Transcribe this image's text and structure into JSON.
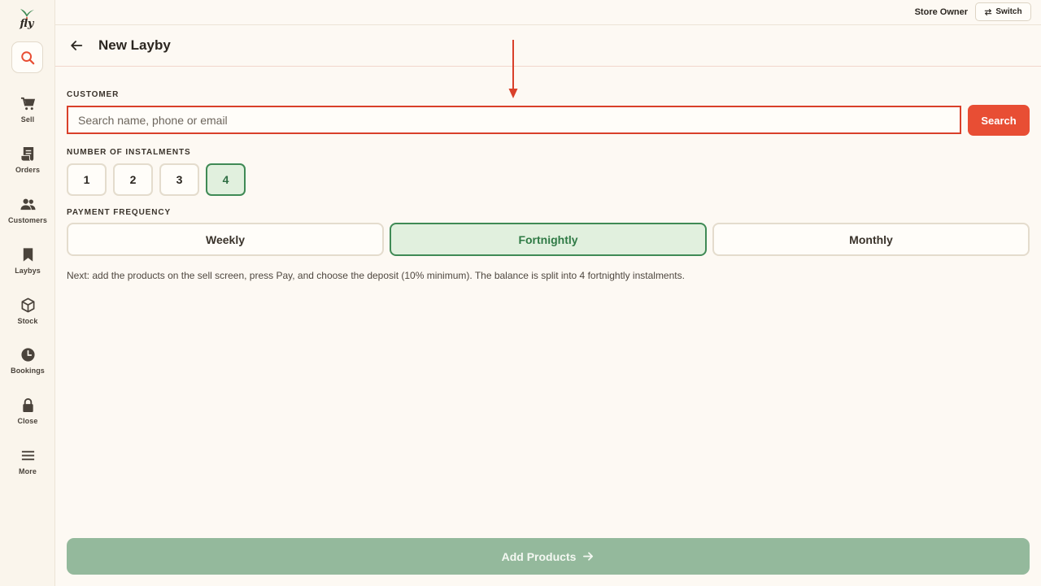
{
  "app": {
    "logo_text": "fly"
  },
  "sidebar": {
    "items": [
      {
        "label": "Sell",
        "icon": "cart-icon"
      },
      {
        "label": "Orders",
        "icon": "receipt-icon"
      },
      {
        "label": "Customers",
        "icon": "users-icon"
      },
      {
        "label": "Laybys",
        "icon": "bookmark-icon"
      },
      {
        "label": "Stock",
        "icon": "box-icon"
      },
      {
        "label": "Bookings",
        "icon": "clock-icon"
      },
      {
        "label": "Close",
        "icon": "lock-icon"
      },
      {
        "label": "More",
        "icon": "menu-icon"
      }
    ]
  },
  "topbar": {
    "user_label": "Store Owner",
    "switch_label": "Switch"
  },
  "header": {
    "title": "New Layby"
  },
  "customer": {
    "label": "CUSTOMER",
    "placeholder": "Search name, phone or email",
    "value": "",
    "search_label": "Search"
  },
  "instalments": {
    "label": "NUMBER OF INSTALMENTS",
    "options": [
      "1",
      "2",
      "3",
      "4"
    ],
    "selected": "4"
  },
  "frequency": {
    "label": "PAYMENT FREQUENCY",
    "options": [
      "Weekly",
      "Fortnightly",
      "Monthly"
    ],
    "selected": "Fortnightly"
  },
  "hint": "Next: add the products on the sell screen, press Pay, and choose the deposit (10% minimum). The balance is split into 4 fortnightly instalments.",
  "footer": {
    "add_products_label": "Add Products"
  },
  "colors": {
    "accent": "#e84e34",
    "selected_bg": "#e1f0de",
    "selected_border": "#3f8a55",
    "primary_disabled": "#94b99c"
  }
}
